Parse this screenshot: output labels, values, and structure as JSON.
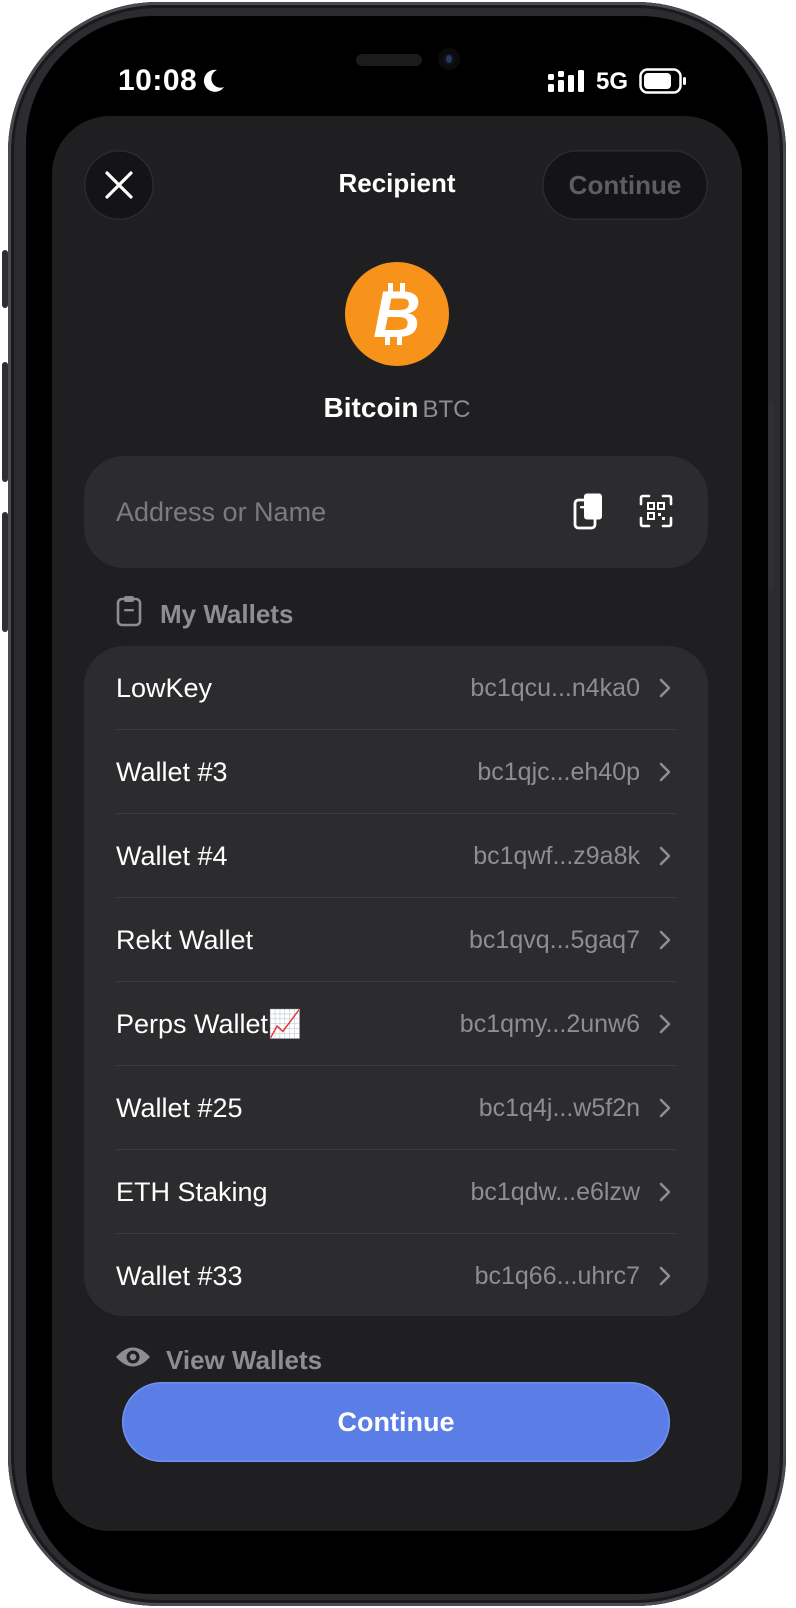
{
  "status_bar": {
    "time": "10:08",
    "network": "5G",
    "icons": [
      "moon-icon",
      "signal-icon",
      "battery-icon"
    ]
  },
  "header": {
    "title": "Recipient",
    "continue_label": "Continue",
    "close_icon": "close-icon"
  },
  "asset": {
    "name": "Bitcoin",
    "symbol": "BTC",
    "icon": "bitcoin-icon",
    "brand_color": "#f7931a"
  },
  "address_field": {
    "placeholder": "Address or Name",
    "value": "",
    "icons": [
      "paste-icon",
      "qr-scan-icon"
    ]
  },
  "my_wallets": {
    "heading": "My Wallets",
    "icon": "clipboard-icon",
    "items": [
      {
        "name": "LowKey",
        "address": "bc1qcu...n4ka0"
      },
      {
        "name": "Wallet #3",
        "address": "bc1qjc...eh40p"
      },
      {
        "name": "Wallet #4",
        "address": "bc1qwf...z9a8k"
      },
      {
        "name": "Rekt Wallet",
        "address": "bc1qvq...5gaq7"
      },
      {
        "name": "Perps Wallet📈",
        "address": "bc1qmy...2unw6"
      },
      {
        "name": "Wallet #25",
        "address": "bc1q4j...w5f2n"
      },
      {
        "name": "ETH Staking",
        "address": "bc1qdw...e6lzw"
      },
      {
        "name": "Wallet #33",
        "address": "bc1q66...uhrc7"
      }
    ]
  },
  "view_wallets": {
    "label": "View Wallets",
    "icon": "eye-icon"
  },
  "footer": {
    "continue_label": "Continue",
    "accent_color": "#5b7ee6"
  }
}
